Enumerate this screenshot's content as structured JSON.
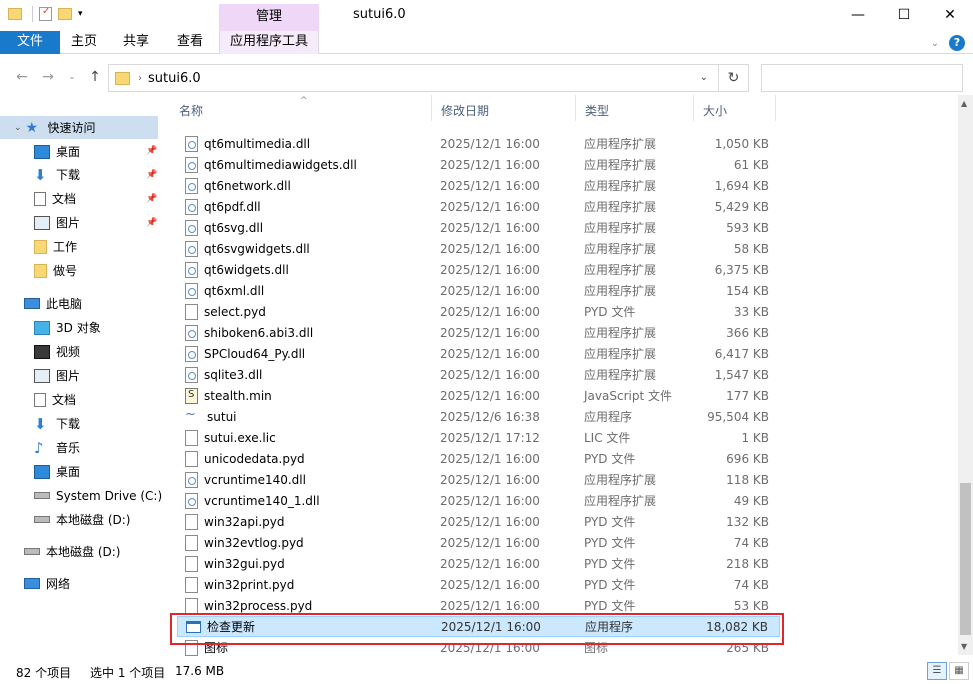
{
  "window": {
    "title": "sutui6.0",
    "context_tab_header": "管理",
    "minimize": "—",
    "maximize": "☐",
    "close": "✕"
  },
  "ribbon": {
    "tabs": [
      {
        "label": "文件"
      },
      {
        "label": "主页"
      },
      {
        "label": "共享"
      },
      {
        "label": "查看"
      },
      {
        "label": "应用程序工具"
      }
    ]
  },
  "address": {
    "path": "sutui6.0",
    "search_placeholder": ""
  },
  "sidebar": {
    "items": [
      {
        "label": "快速访问",
        "icon": "star-icon"
      },
      {
        "label": "桌面",
        "icon": "desktop-icon",
        "pinned": true
      },
      {
        "label": "下载",
        "icon": "download-icon",
        "pinned": true
      },
      {
        "label": "文档",
        "icon": "document-icon",
        "pinned": true
      },
      {
        "label": "图片",
        "icon": "picture-icon",
        "pinned": true
      },
      {
        "label": "工作",
        "icon": "folder-icon"
      },
      {
        "label": "做号",
        "icon": "folder-icon"
      },
      {
        "label": "此电脑",
        "icon": "computer-icon"
      },
      {
        "label": "3D 对象",
        "icon": "cube-icon"
      },
      {
        "label": "视频",
        "icon": "video-icon"
      },
      {
        "label": "图片",
        "icon": "picture-icon"
      },
      {
        "label": "文档",
        "icon": "document-icon"
      },
      {
        "label": "下载",
        "icon": "download-icon"
      },
      {
        "label": "音乐",
        "icon": "music-icon"
      },
      {
        "label": "桌面",
        "icon": "desktop-icon"
      },
      {
        "label": "System Drive (C:)",
        "icon": "drive-icon"
      },
      {
        "label": "本地磁盘 (D:)",
        "icon": "drive-icon"
      },
      {
        "label": "本地磁盘 (D:)",
        "icon": "drive-icon"
      },
      {
        "label": "网络",
        "icon": "network-icon"
      }
    ]
  },
  "columns": {
    "name": "名称",
    "date": "修改日期",
    "type": "类型",
    "size": "大小"
  },
  "files": [
    {
      "name": "qt6multimedia.dll",
      "date": "2025/12/1 16:00",
      "type": "应用程序扩展",
      "size": "1,050 KB",
      "icon": "dll"
    },
    {
      "name": "qt6multimediawidgets.dll",
      "date": "2025/12/1 16:00",
      "type": "应用程序扩展",
      "size": "61 KB",
      "icon": "dll"
    },
    {
      "name": "qt6network.dll",
      "date": "2025/12/1 16:00",
      "type": "应用程序扩展",
      "size": "1,694 KB",
      "icon": "dll"
    },
    {
      "name": "qt6pdf.dll",
      "date": "2025/12/1 16:00",
      "type": "应用程序扩展",
      "size": "5,429 KB",
      "icon": "dll"
    },
    {
      "name": "qt6svg.dll",
      "date": "2025/12/1 16:00",
      "type": "应用程序扩展",
      "size": "593 KB",
      "icon": "dll"
    },
    {
      "name": "qt6svgwidgets.dll",
      "date": "2025/12/1 16:00",
      "type": "应用程序扩展",
      "size": "58 KB",
      "icon": "dll"
    },
    {
      "name": "qt6widgets.dll",
      "date": "2025/12/1 16:00",
      "type": "应用程序扩展",
      "size": "6,375 KB",
      "icon": "dll"
    },
    {
      "name": "qt6xml.dll",
      "date": "2025/12/1 16:00",
      "type": "应用程序扩展",
      "size": "154 KB",
      "icon": "dll"
    },
    {
      "name": "select.pyd",
      "date": "2025/12/1 16:00",
      "type": "PYD 文件",
      "size": "33 KB",
      "icon": "file"
    },
    {
      "name": "shiboken6.abi3.dll",
      "date": "2025/12/1 16:00",
      "type": "应用程序扩展",
      "size": "366 KB",
      "icon": "dll"
    },
    {
      "name": "SPCloud64_Py.dll",
      "date": "2025/12/1 16:00",
      "type": "应用程序扩展",
      "size": "6,417 KB",
      "icon": "dll"
    },
    {
      "name": "sqlite3.dll",
      "date": "2025/12/1 16:00",
      "type": "应用程序扩展",
      "size": "1,547 KB",
      "icon": "dll"
    },
    {
      "name": "stealth.min",
      "date": "2025/12/1 16:00",
      "type": "JavaScript 文件",
      "size": "177 KB",
      "icon": "js"
    },
    {
      "name": "sutui",
      "date": "2025/12/6 16:38",
      "type": "应用程序",
      "size": "95,504 KB",
      "icon": "exe"
    },
    {
      "name": "sutui.exe.lic",
      "date": "2025/12/1 17:12",
      "type": "LIC 文件",
      "size": "1 KB",
      "icon": "file"
    },
    {
      "name": "unicodedata.pyd",
      "date": "2025/12/1 16:00",
      "type": "PYD 文件",
      "size": "696 KB",
      "icon": "file"
    },
    {
      "name": "vcruntime140.dll",
      "date": "2025/12/1 16:00",
      "type": "应用程序扩展",
      "size": "118 KB",
      "icon": "dll"
    },
    {
      "name": "vcruntime140_1.dll",
      "date": "2025/12/1 16:00",
      "type": "应用程序扩展",
      "size": "49 KB",
      "icon": "dll"
    },
    {
      "name": "win32api.pyd",
      "date": "2025/12/1 16:00",
      "type": "PYD 文件",
      "size": "132 KB",
      "icon": "file"
    },
    {
      "name": "win32evtlog.pyd",
      "date": "2025/12/1 16:00",
      "type": "PYD 文件",
      "size": "74 KB",
      "icon": "file"
    },
    {
      "name": "win32gui.pyd",
      "date": "2025/12/1 16:00",
      "type": "PYD 文件",
      "size": "218 KB",
      "icon": "file"
    },
    {
      "name": "win32print.pyd",
      "date": "2025/12/1 16:00",
      "type": "PYD 文件",
      "size": "74 KB",
      "icon": "file"
    },
    {
      "name": "win32process.pyd",
      "date": "2025/12/1 16:00",
      "type": "PYD 文件",
      "size": "53 KB",
      "icon": "file"
    },
    {
      "name": "检查更新",
      "date": "2025/12/1 16:00",
      "type": "应用程序",
      "size": "18,082 KB",
      "icon": "app",
      "selected": true
    },
    {
      "name": "图标",
      "date": "2025/12/1 16:00",
      "type": "图标",
      "size": "265 KB",
      "icon": "file"
    }
  ],
  "status": {
    "item_count": "82 个项目",
    "selected": "选中 1 个项目",
    "selected_size": "17.6 MB"
  },
  "colors": {
    "accent": "#1979ca",
    "selection": "#cce8ff",
    "highlight_box": "#e0272e"
  }
}
